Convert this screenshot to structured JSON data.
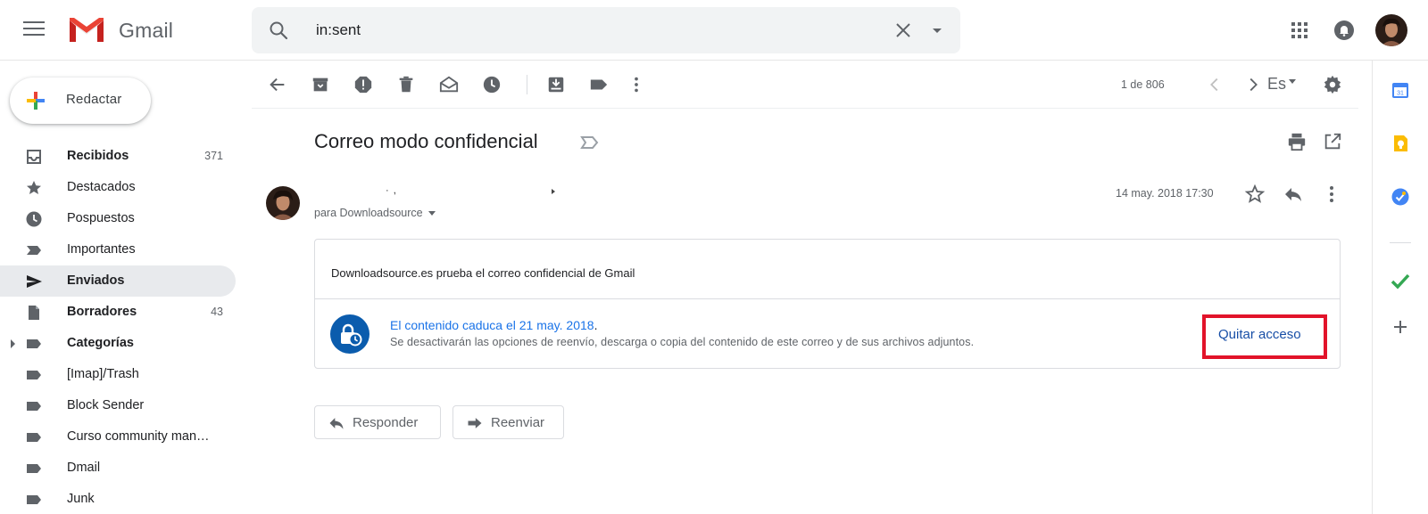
{
  "app": {
    "name": "Gmail"
  },
  "search": {
    "value": "in:sent"
  },
  "compose": {
    "label": "Redactar"
  },
  "nav": [
    {
      "label": "Recibidos",
      "count": "371"
    },
    {
      "label": "Destacados",
      "count": ""
    },
    {
      "label": "Pospuestos",
      "count": ""
    },
    {
      "label": "Importantes",
      "count": ""
    },
    {
      "label": "Enviados",
      "count": ""
    },
    {
      "label": "Borradores",
      "count": "43"
    },
    {
      "label": "Categorías",
      "count": ""
    },
    {
      "label": "[Imap]/Trash",
      "count": ""
    },
    {
      "label": "Block Sender",
      "count": ""
    },
    {
      "label": "Curso community man…",
      "count": ""
    },
    {
      "label": "Dmail",
      "count": ""
    },
    {
      "label": "Junk",
      "count": ""
    }
  ],
  "toolbar": {
    "pager": "1 de 806",
    "language": "Es"
  },
  "message": {
    "subject": "Correo modo confidencial",
    "sender": "· ,",
    "recipient": "para Downloadsource",
    "date": "14 may. 2018 17:30",
    "body": "Downloadsource.es prueba el correo confidencial de Gmail",
    "confidential_title": "El contenido caduca el 21 may. 2018",
    "confidential_title_end": ".",
    "confidential_desc": "Se desactivarán las opciones de reenvío, descarga o copia del contenido de este correo y de sus archivos adjuntos.",
    "revoke_label": "Quitar acceso"
  },
  "actions": {
    "reply_label": "Responder",
    "forward_label": "Reenviar"
  },
  "colors": {
    "accent": "#1a73e8",
    "highlight": "#e2132a",
    "active_nav": "#e8eaed",
    "confidential_icon": "#0b5cad"
  }
}
